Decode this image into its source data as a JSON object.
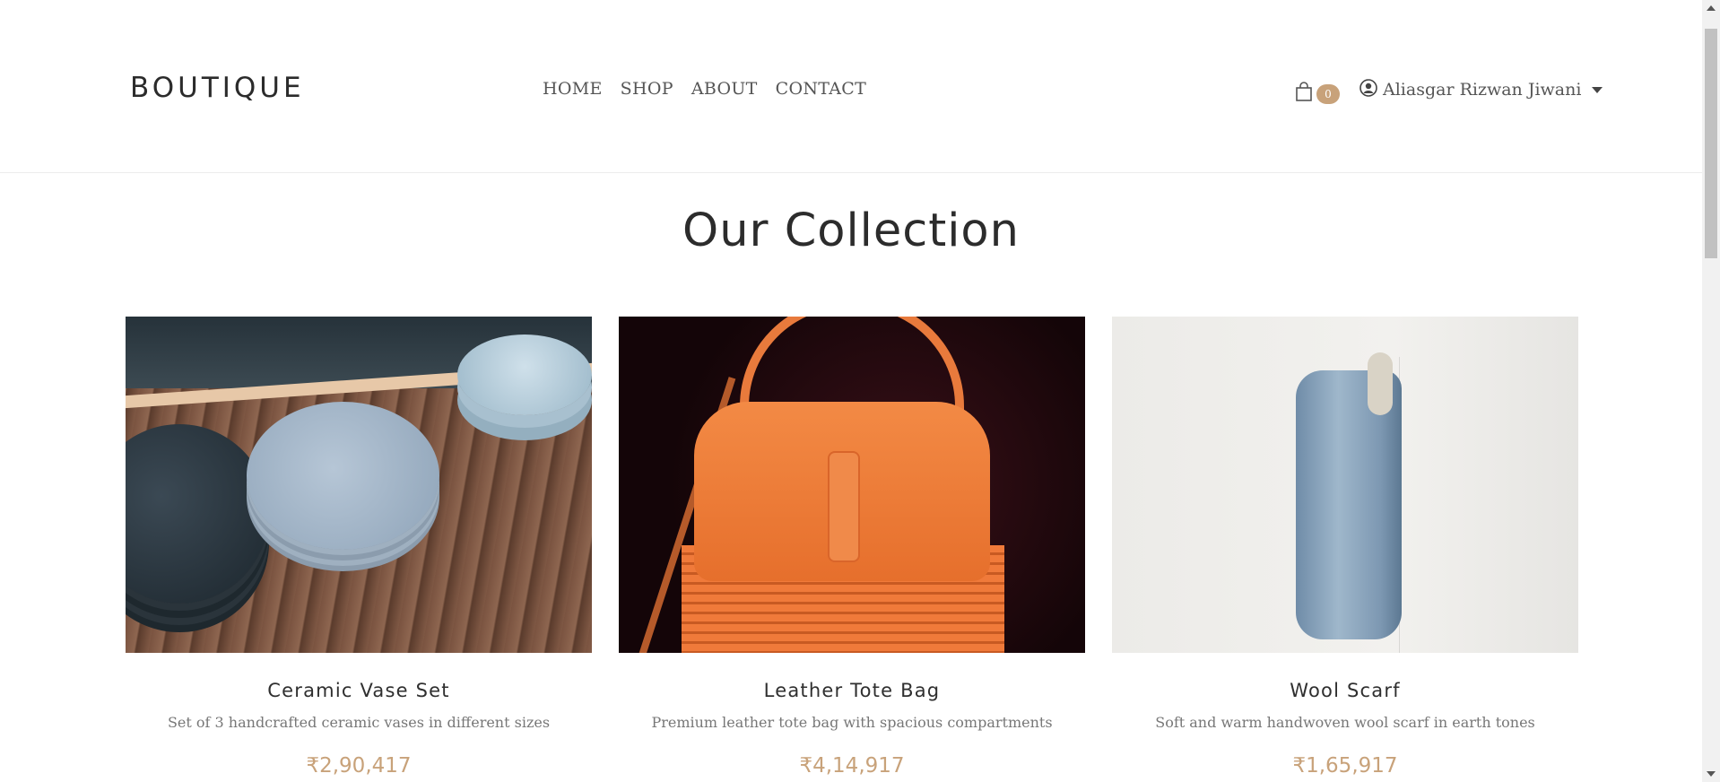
{
  "header": {
    "logo": "BOUTIQUE",
    "nav": [
      "HOME",
      "SHOP",
      "ABOUT",
      "CONTACT"
    ],
    "cart_count": "0",
    "user_name": "Aliasgar Rizwan Jiwani"
  },
  "collection": {
    "title": "Our Collection",
    "products": [
      {
        "name": "Ceramic Vase Set",
        "description": "Set of 3 handcrafted ceramic vases in different sizes",
        "price": "₹2,90,417"
      },
      {
        "name": "Leather Tote Bag",
        "description": "Premium leather tote bag with spacious compartments",
        "price": "₹4,14,917"
      },
      {
        "name": "Wool Scarf",
        "description": "Soft and warm handwoven wool scarf in earth tones",
        "price": "₹1,65,917"
      }
    ]
  },
  "colors": {
    "accent": "#c8a27a",
    "text": "#333333",
    "muted": "#777777"
  },
  "icons": [
    "shopping-bag-icon",
    "user-circle-icon",
    "caret-down-icon"
  ]
}
